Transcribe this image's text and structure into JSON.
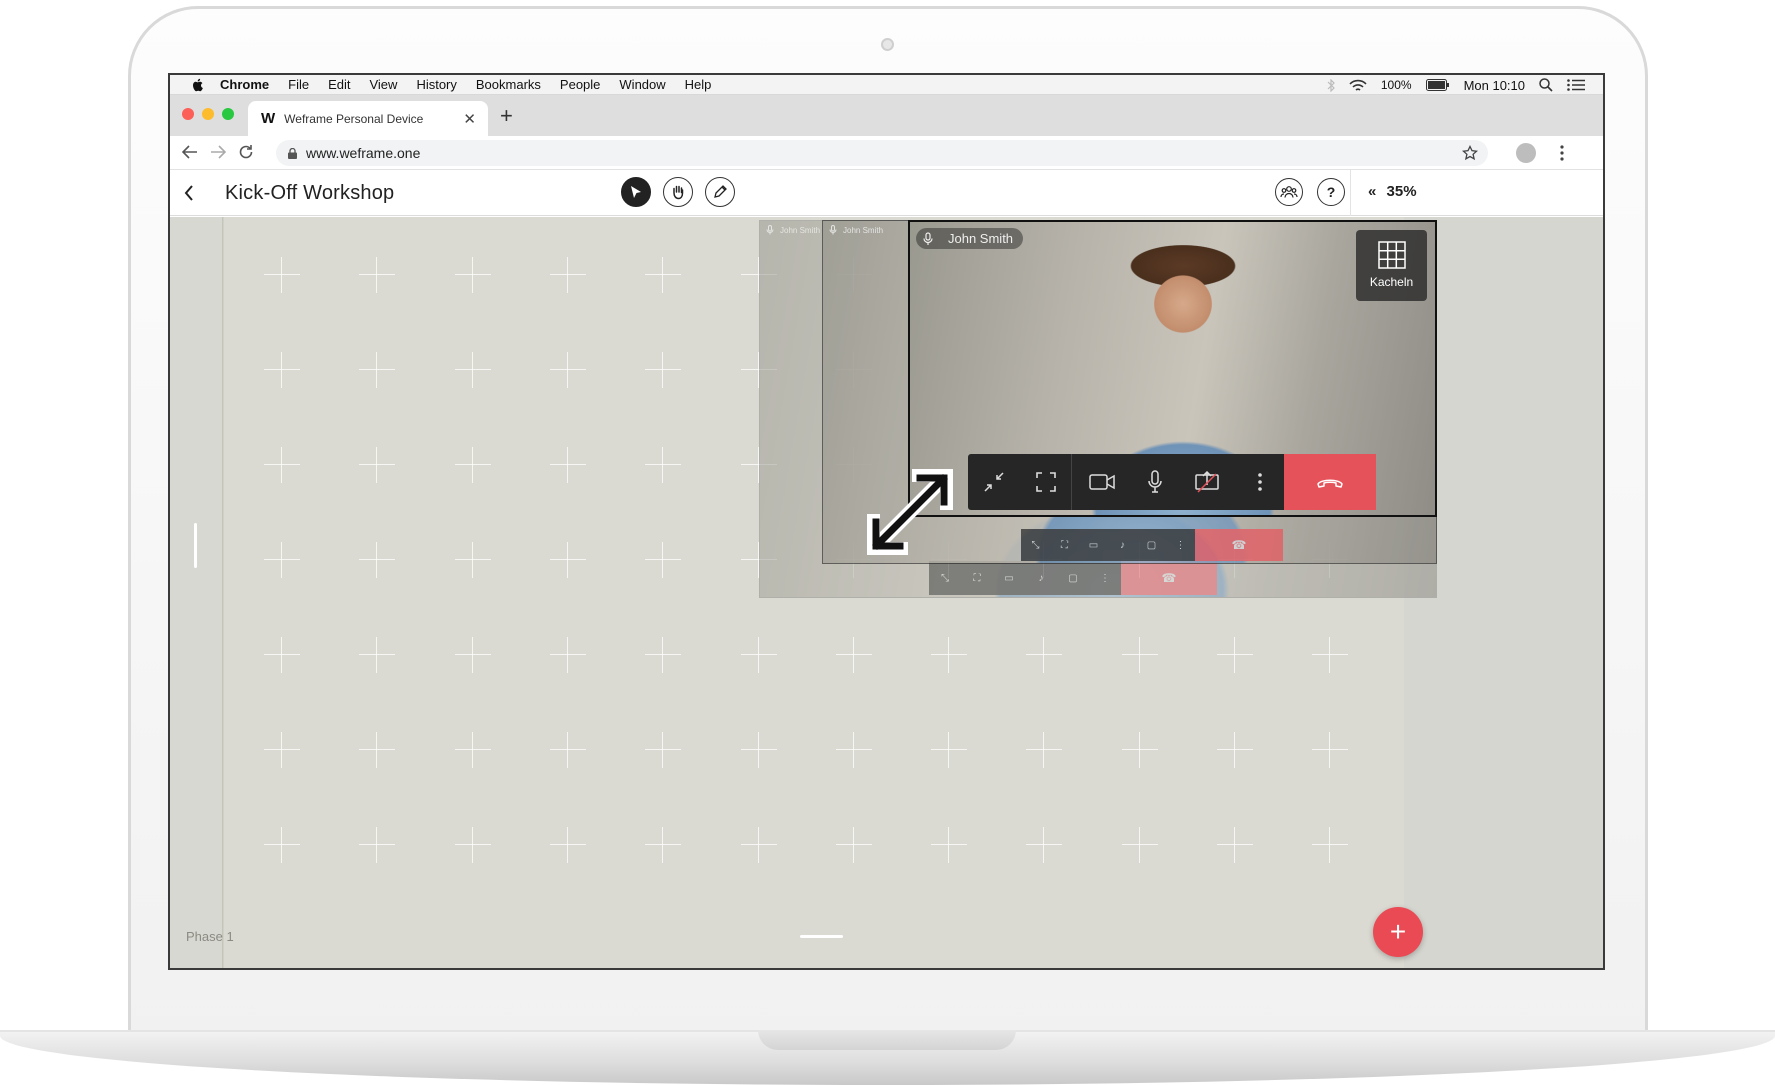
{
  "menubar": {
    "app": "Chrome",
    "items": [
      "File",
      "Edit",
      "View",
      "History",
      "Bookmarks",
      "People",
      "Window",
      "Help"
    ],
    "battery": "100%",
    "clock": "Mon 10:10"
  },
  "browser": {
    "tab_title": "Weframe Personal Device",
    "tab_logo": "W",
    "tab_close": "✕",
    "new_tab": "+",
    "url": "www.weframe.one"
  },
  "app": {
    "back_icon": "‹",
    "title": "Kick-Off Workshop",
    "help": "?",
    "collapse": "«",
    "zoom": "35%",
    "phase_label": "Phase 1",
    "fab": "+"
  },
  "video": {
    "participant": "John Smith",
    "tile_button": "Kacheln"
  },
  "colors": {
    "accent": "#ea4a53",
    "hangup": "#e6525a",
    "canvas": "#dadad2"
  }
}
